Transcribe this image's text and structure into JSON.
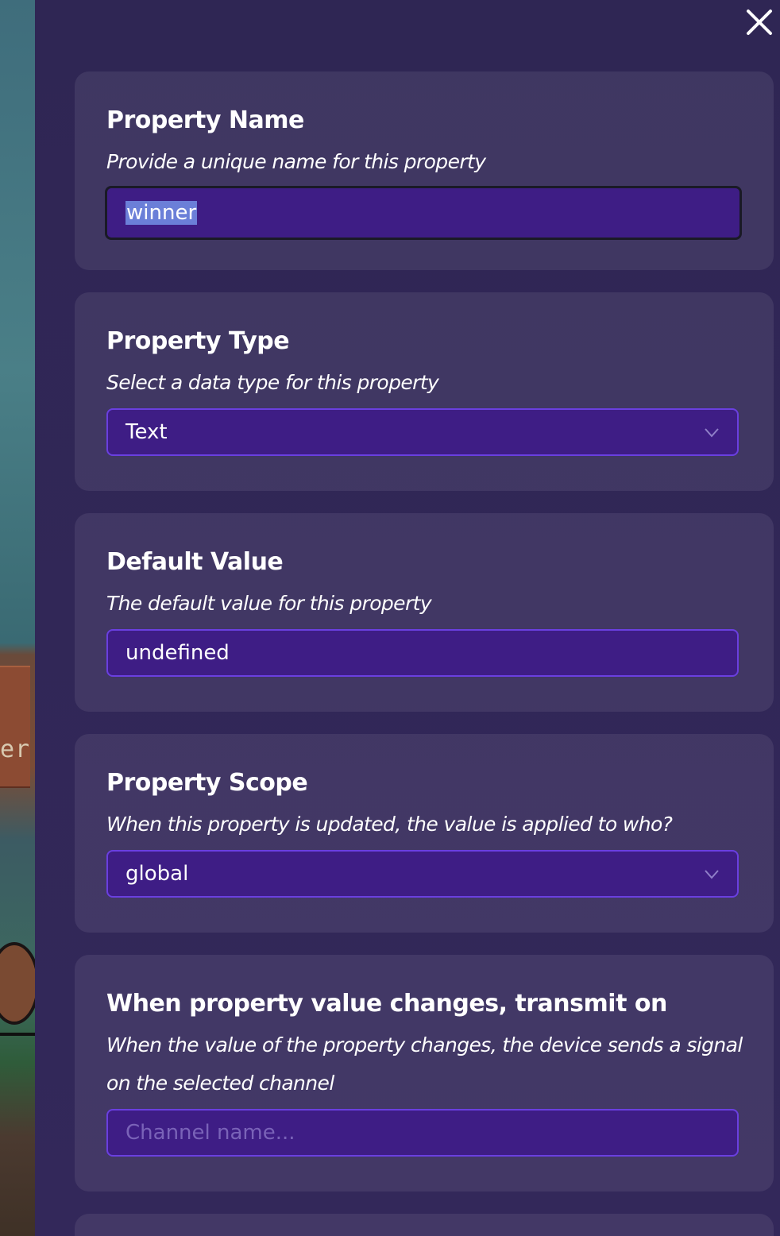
{
  "sections": {
    "property_name": {
      "title": "Property Name",
      "description": "Provide a unique name for this property",
      "value": "winner"
    },
    "property_type": {
      "title": "Property Type",
      "description": "Select a data type for this property",
      "selected": "Text"
    },
    "default_value": {
      "title": "Default Value",
      "description": "The default value for this property",
      "value": "undefined"
    },
    "property_scope": {
      "title": "Property Scope",
      "description": "When this property is updated, the value is applied to who?",
      "selected": "global"
    },
    "transmit": {
      "title": "When property value changes, transmit on",
      "description_line1": "When the value of the property changes, the device sends a signal",
      "description_line2": "on the selected channel",
      "placeholder": "Channel name..."
    }
  },
  "background": {
    "sign_text": "er"
  },
  "icons": {
    "close": "close-icon",
    "dropdown": "chevron-down-icon"
  },
  "colors": {
    "panel": "#2f2654",
    "input_fill": "#3e1d85",
    "input_border": "#6a3fe0",
    "selection": "#6b7fd8"
  }
}
